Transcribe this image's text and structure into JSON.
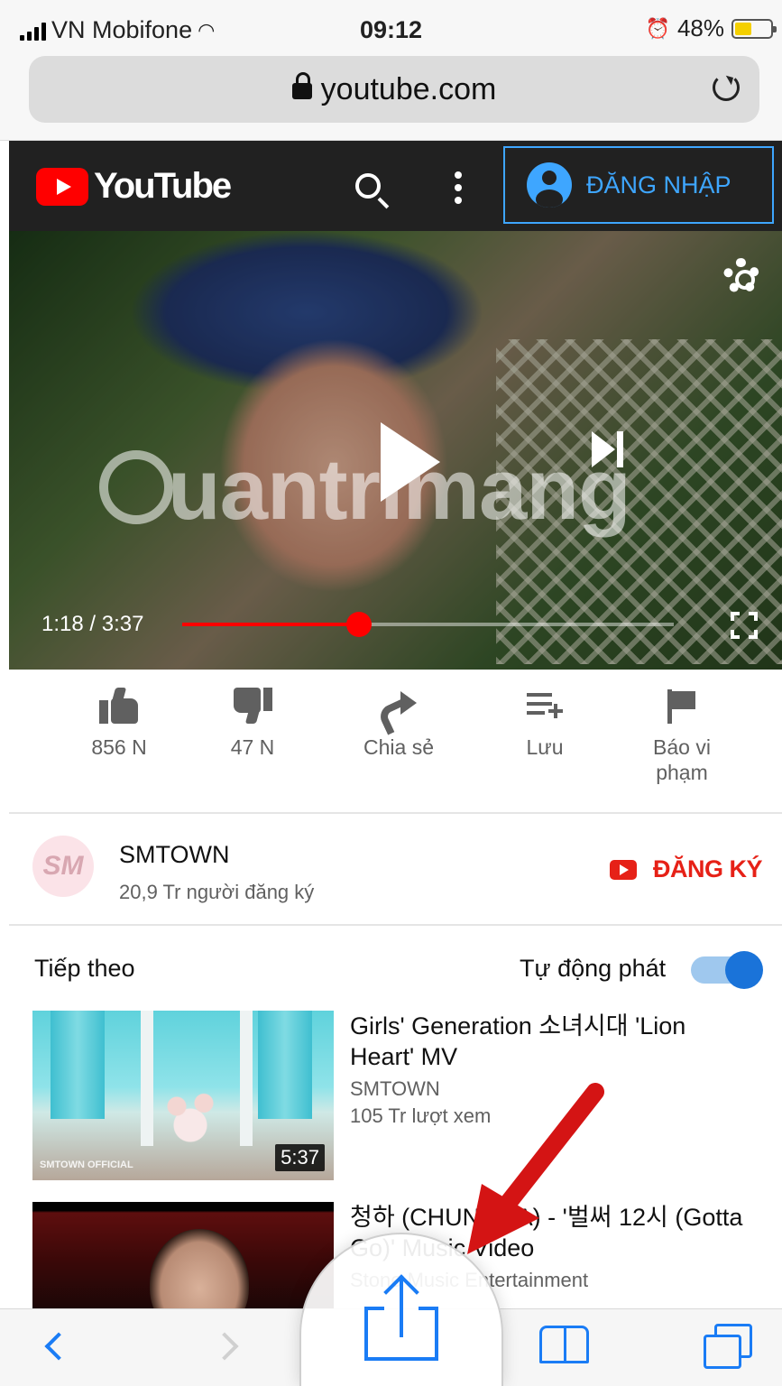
{
  "status_bar": {
    "carrier": "VN Mobifone",
    "time": "09:12",
    "battery_percent": "48%",
    "battery_level": 0.48
  },
  "browser": {
    "url": "youtube.com"
  },
  "youtube_header": {
    "logo_text": "YouTube",
    "signin_label": "ĐĂNG NHẬP"
  },
  "player": {
    "watermark": "uantrimang",
    "current_time": "1:18",
    "duration": "3:37",
    "time_label": "1:18 / 3:37",
    "progress_fraction": 0.36
  },
  "actions": [
    {
      "label": "856 N",
      "icon": "thumb-up-icon"
    },
    {
      "label": "47 N",
      "icon": "thumb-down-icon"
    },
    {
      "label": "Chia sẻ",
      "icon": "share-icon"
    },
    {
      "label": "Lưu",
      "icon": "save-to-playlist-icon"
    },
    {
      "label": "Báo vi phạm",
      "icon": "flag-icon"
    }
  ],
  "channel": {
    "avatar_text": "SM",
    "name": "SMTOWN",
    "subscribers": "20,9 Tr người đăng ký",
    "subscribe_label": "ĐĂNG KÝ"
  },
  "up_next": {
    "title": "Tiếp theo",
    "autoplay_label": "Tự động phát",
    "autoplay_on": true,
    "videos": [
      {
        "title": "Girls' Generation 소녀시대 'Lion Heart' MV",
        "channel": "SMTOWN",
        "views": "105 Tr lượt xem",
        "duration": "5:37",
        "badge": "SMTOWN OFFICIAL"
      },
      {
        "title": "청하 (CHUNGHA) - '벌써 12시 (Gotta Go)' Music Video",
        "channel": "Stone Music Entertainment"
      }
    ]
  },
  "colors": {
    "youtube_red": "#ff0000",
    "ios_blue": "#1a7cf5",
    "header_bg": "#212121",
    "signin_blue": "#3ea6ff"
  }
}
